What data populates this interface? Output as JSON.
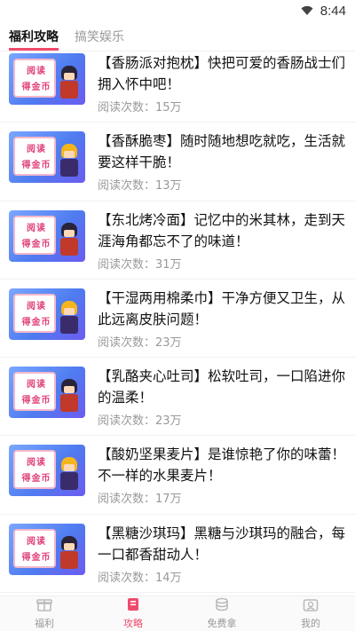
{
  "status_bar": {
    "time": "8:44",
    "wifi_icon": "wifi-icon",
    "battery_icon": "battery-icon"
  },
  "tabs": [
    {
      "label": "福利攻略",
      "active": true
    },
    {
      "label": "搞笑娱乐",
      "active": false
    }
  ],
  "thumbnail": {
    "line1": "阅读",
    "line2": "得金币"
  },
  "articles": [
    {
      "title": "【香肠派对抱枕】快把可爱的香肠战士们拥入怀中吧！",
      "reads": "阅读次数：15万"
    },
    {
      "title": "【香酥脆枣】随时随地想吃就吃，生活就要这样干脆！",
      "reads": "阅读次数：13万"
    },
    {
      "title": "【东北烤冷面】记忆中的米其林，走到天涯海角都忘不了的味道！",
      "reads": "阅读次数：31万"
    },
    {
      "title": "【干湿两用棉柔巾】干净方便又卫生，从此远离皮肤问题！",
      "reads": "阅读次数：23万"
    },
    {
      "title": "【乳酪夹心吐司】松软吐司，一口陷进你的温柔！",
      "reads": "阅读次数：23万"
    },
    {
      "title": "【酸奶坚果麦片】是谁惊艳了你的味蕾！不一样的水果麦片！",
      "reads": "阅读次数：17万"
    },
    {
      "title": "【黑糖沙琪玛】黑糖与沙琪玛的融合，每一口都香甜动人！",
      "reads": "阅读次数：14万"
    }
  ],
  "bottom_nav": [
    {
      "label": "福利",
      "icon": "gift-icon",
      "active": false
    },
    {
      "label": "攻略",
      "icon": "book-icon",
      "active": true
    },
    {
      "label": "免费拿",
      "icon": "coins-icon",
      "active": false
    },
    {
      "label": "我的",
      "icon": "profile-icon",
      "active": false
    }
  ],
  "colors": {
    "accent": "#f04a6b",
    "inactive": "#999999",
    "thumb_blue": "#4f7cf0"
  }
}
